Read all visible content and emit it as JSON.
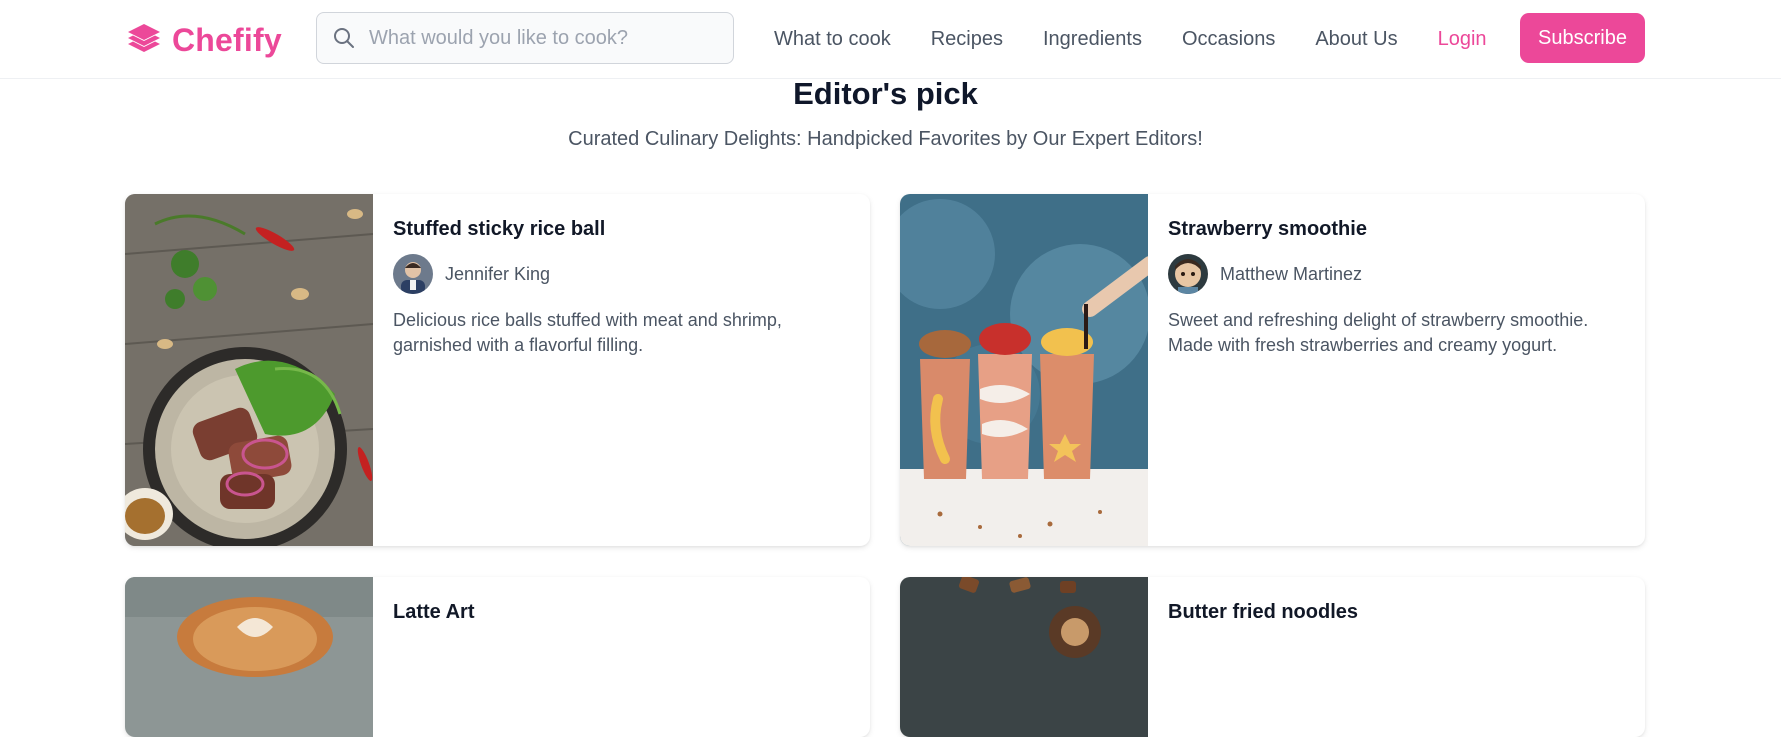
{
  "header": {
    "brand": "Chefify",
    "search_placeholder": "What would you like to cook?",
    "nav": [
      "What to cook",
      "Recipes",
      "Ingredients",
      "Occasions",
      "About Us"
    ],
    "login_label": "Login",
    "subscribe_label": "Subscribe"
  },
  "section": {
    "title": "Editor's pick",
    "subtitle": "Curated Culinary Delights: Handpicked Favorites by Our Expert Editors!"
  },
  "cards": [
    {
      "title": "Stuffed sticky rice ball",
      "author": "Jennifer King",
      "description": "Delicious rice balls stuffed with meat and shrimp, garnished with a flavorful filling."
    },
    {
      "title": "Strawberry smoothie",
      "author": "Matthew Martinez",
      "description": "Sweet and refreshing delight of strawberry smoothie. Made with fresh strawberries and creamy yogurt."
    },
    {
      "title": "Latte Art"
    },
    {
      "title": "Butter fried noodles"
    }
  ],
  "colors": {
    "brand": "#ec4899",
    "text": "#111827",
    "muted": "#4b5563"
  }
}
